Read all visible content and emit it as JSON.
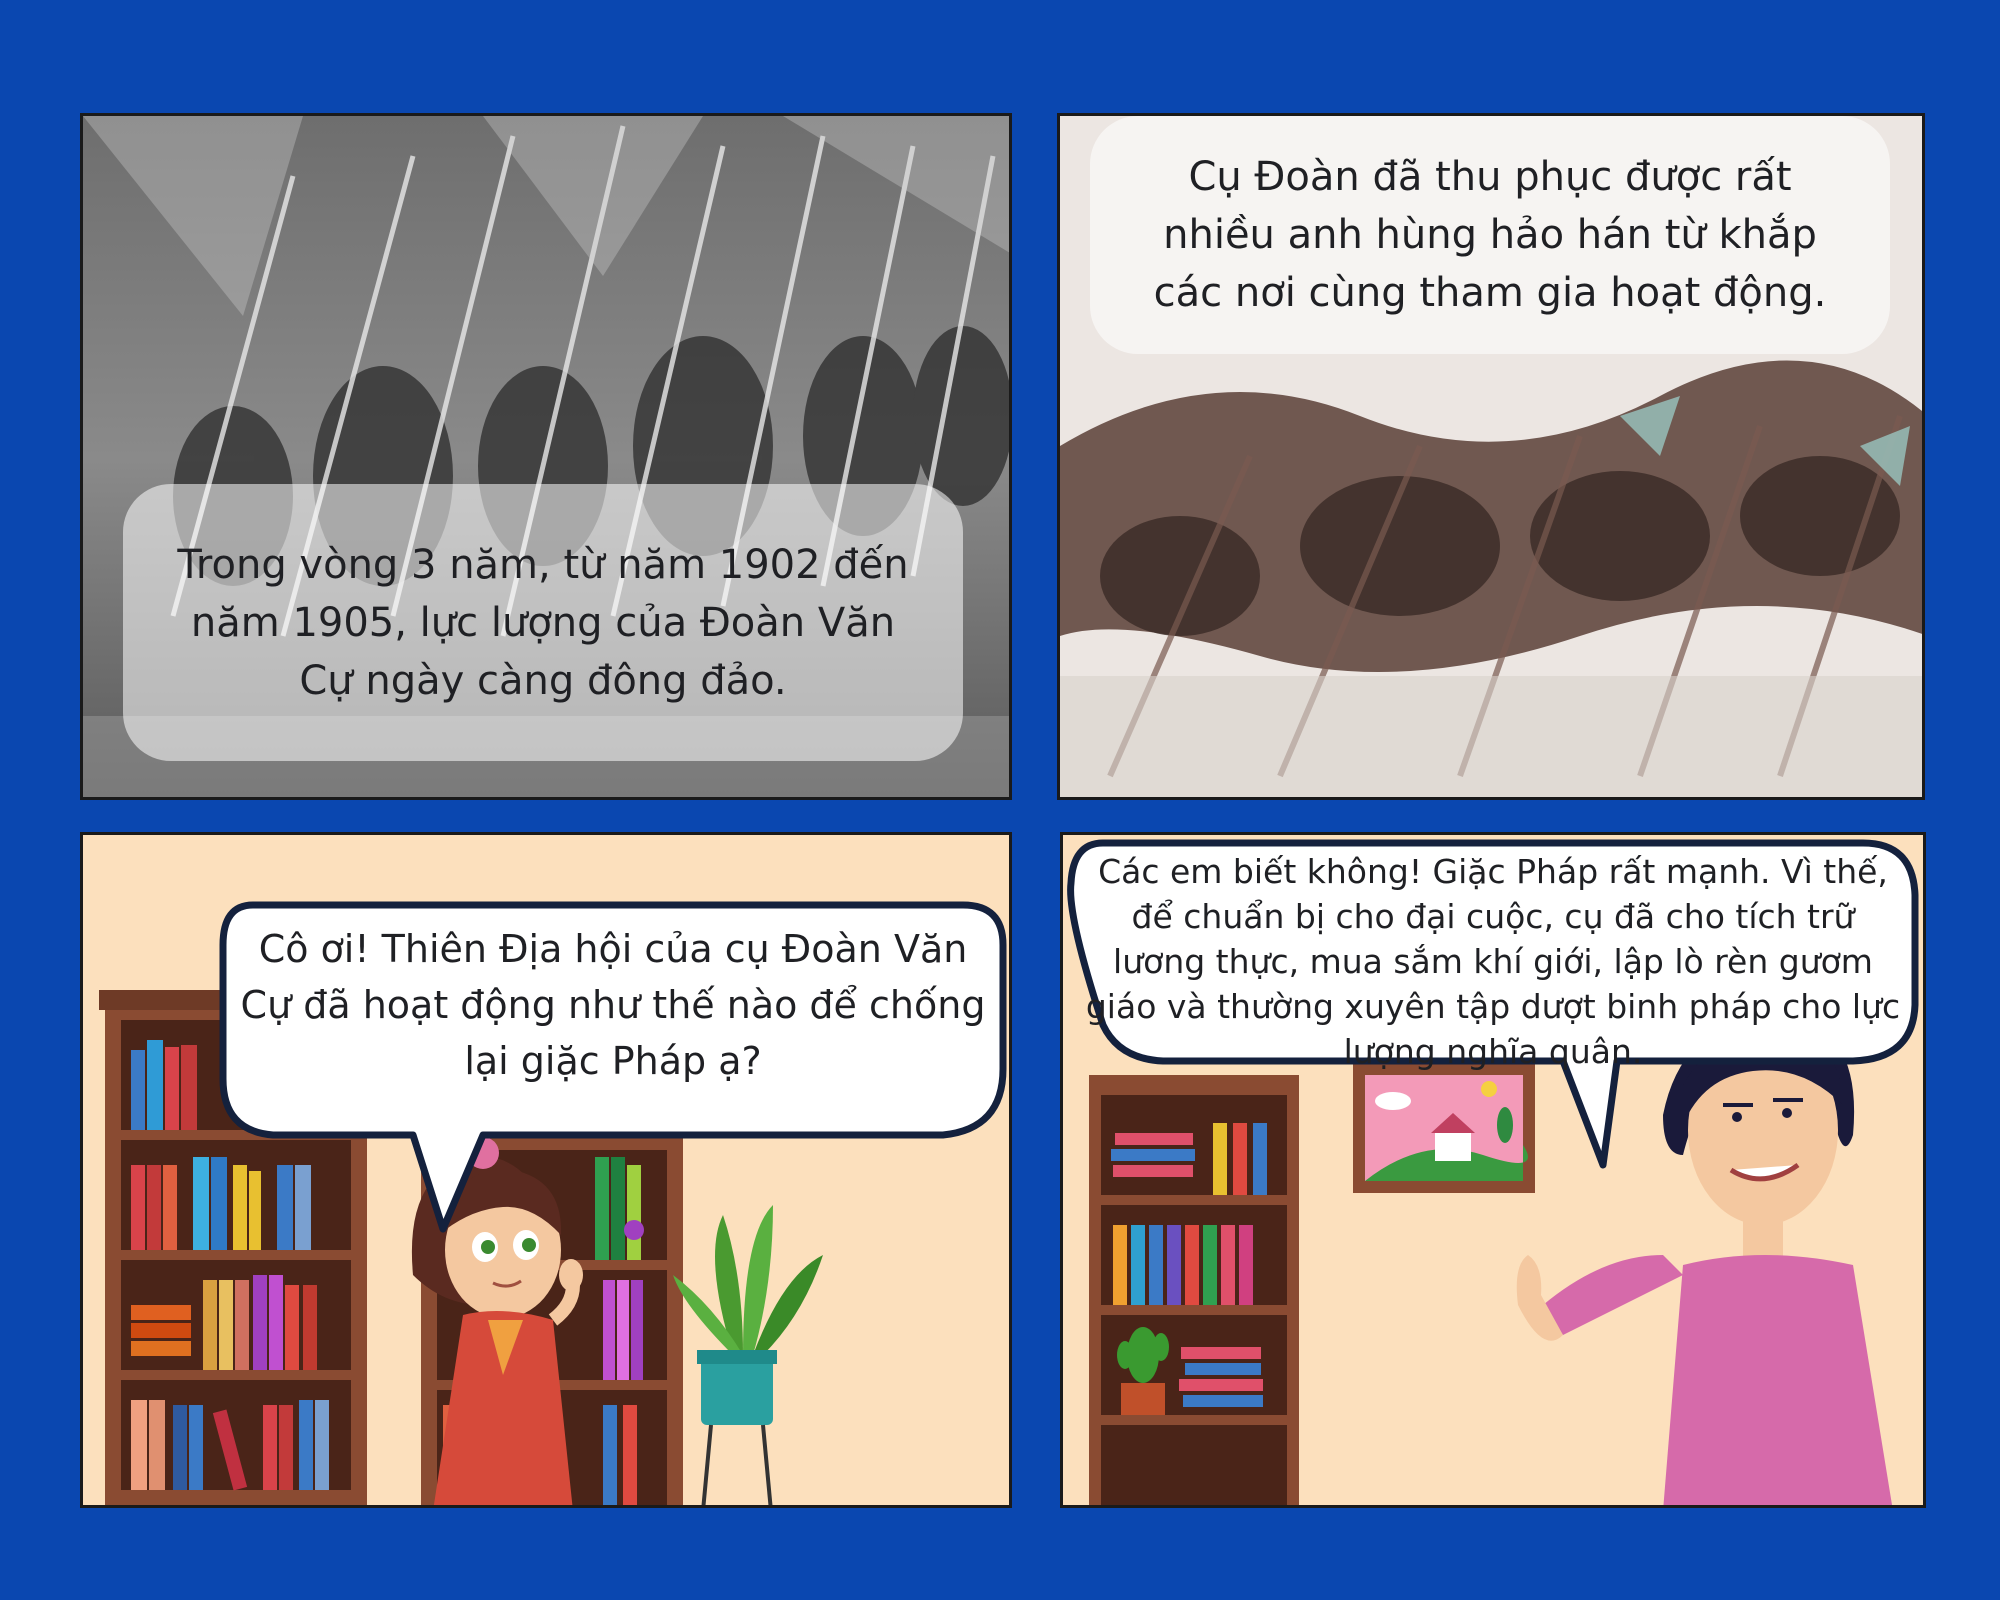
{
  "panel1": {
    "caption": "Trong vòng 3 năm, từ năm 1902 đến năm 1905, lực lượng của Đoàn Văn Cự ngày càng đông đảo."
  },
  "panel2": {
    "caption": "Cụ Đoàn đã thu phục được rất nhiều anh hùng hảo hán từ khắp các nơi cùng tham gia hoạt động."
  },
  "panel3": {
    "speech": "Cô ơi! Thiên Địa hội của cụ Đoàn Văn Cự đã hoạt động như thế nào để chống lại giặc Pháp ạ?"
  },
  "panel4": {
    "speech": "Các em biết không! Giặc Pháp rất mạnh. Vì thế, để chuẩn bị cho đại cuộc, cụ đã cho tích trữ lương thực, mua sắm khí giới, lập lò rèn gươm giáo và thường xuyên tập dượt binh pháp cho lực lượng nghĩa quân."
  },
  "colors": {
    "background": "#0a47b0",
    "wall": "#fce0bd",
    "bubble_border": "#14213d"
  }
}
